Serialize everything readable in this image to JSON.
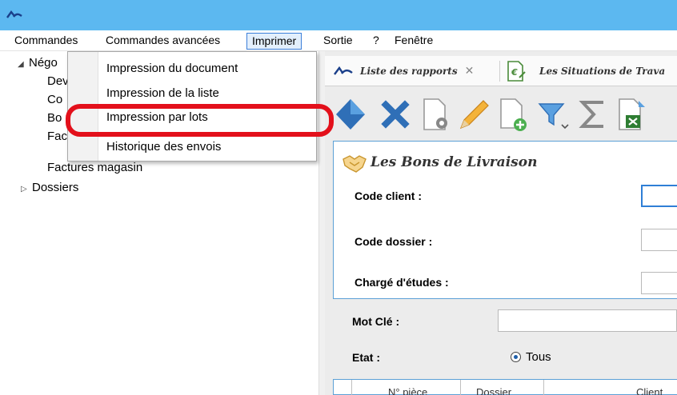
{
  "window": {
    "logo_icon": "app-logo-icon",
    "colors": {
      "titlebar": "#5cb8f0",
      "highlight_outline": "#e3101b",
      "panel_border": "#5ba0d6"
    }
  },
  "menubar": {
    "items": [
      {
        "label": "Commandes"
      },
      {
        "label": "Commandes avancées"
      },
      {
        "label": "Imprimer",
        "active": true
      },
      {
        "label": "Sortie"
      },
      {
        "label": "?"
      },
      {
        "label": "Fenêtre"
      }
    ]
  },
  "tree": {
    "items": [
      {
        "label": "Négo",
        "expanded": true
      },
      {
        "label": "Dev"
      },
      {
        "label": "Co"
      },
      {
        "label": "Bo"
      },
      {
        "label": "Fac"
      },
      {
        "label": "Factures magasin"
      },
      {
        "label": "Dossiers",
        "expanded": false
      }
    ]
  },
  "print_menu": {
    "items": [
      {
        "label": "Impression du document"
      },
      {
        "label": "Impression de la liste"
      },
      {
        "label": "Impression par lots",
        "highlighted": true
      },
      {
        "label": "Historique des envois"
      }
    ]
  },
  "tabs": [
    {
      "label": "Liste des rapports",
      "icon": "report-list-icon",
      "closable": true
    },
    {
      "label": "Les Situations de Trava",
      "icon": "invoice-euro-icon"
    }
  ],
  "toolbar": {
    "buttons": [
      {
        "icon": "diamond-icon"
      },
      {
        "icon": "delete-icon"
      },
      {
        "icon": "document-settings-icon"
      },
      {
        "icon": "pencil-icon"
      },
      {
        "icon": "add-document-icon"
      },
      {
        "icon": "filter-icon"
      },
      {
        "icon": "sum-icon"
      },
      {
        "icon": "excel-export-icon"
      }
    ]
  },
  "form": {
    "title": "Les Bons de Livraison",
    "title_icon": "handshake-icon",
    "fields": [
      {
        "label": "Code client :",
        "value": ""
      },
      {
        "label": "Code dossier :",
        "value": ""
      },
      {
        "label": "Chargé d'études :",
        "value": ""
      }
    ],
    "keyword": {
      "label": "Mot Clé :",
      "value": ""
    },
    "state": {
      "label": "Etat :",
      "option": "Tous",
      "selected": true
    }
  },
  "grid": {
    "columns": [
      "N° pièce",
      "Dossier",
      "Client"
    ]
  }
}
